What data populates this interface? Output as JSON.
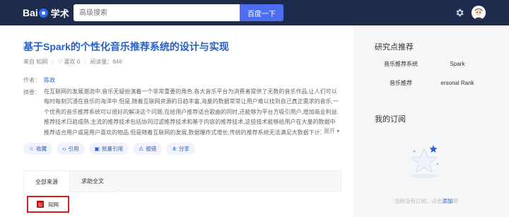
{
  "topbar": {
    "logo_text": "Bai",
    "logo_du": "du",
    "logo_xueshu": "学术",
    "search_placeholder": "高级搜索",
    "search_button": "百度一下"
  },
  "paper": {
    "title": "基于Spark的个性化音乐推荐系统的设计与实现",
    "source": "来自 知网",
    "likes": "喜欢 0",
    "reads": "阅读量：646",
    "author_label": "作者：",
    "author": "陈政",
    "abstract_label": "摘要：",
    "abstract": "在互联网的发展潮流中,音乐无疑扮演着一个非常重要的角色.各大音乐平台为消费者提供了无数的音乐作品,让人们可以每时每刻沉浸在音乐的海洋中.但是,随着互联网资源的日趋丰富,海量的数据常常让用户难以找到自己真正需求的音乐,一个优秀的音乐推荐系统可以很好的解决这个问题,在给用户推荐适合歌曲的同时,还能够为平台方吸引用户,增加商业利益.推荐技术日趋成熟,主流的推荐技术包括协同过滤推荐技术和基于内容的推荐技术,这些技术能够给用户在大量的数据中推荐适合用户或是用户喜欢的物品.但是随着互联网的发展,数据爆炸式增长,传统的推荐系统无法满足大数据下计算的需求,在准确度上也",
    "expand": "展开"
  },
  "actions": [
    {
      "icon": "star-icon",
      "label": "收藏"
    },
    {
      "icon": "quote-icon",
      "label": "引用"
    },
    {
      "icon": "batch-icon",
      "label": "批量引用"
    },
    {
      "icon": "warning-icon",
      "label": "报错"
    },
    {
      "icon": "share-icon",
      "label": "分享"
    }
  ],
  "tabs": {
    "all_sources": "全部来源",
    "request_fulltext": "求助全文"
  },
  "source_item": {
    "logo": "知",
    "label": "知网"
  },
  "sidebar": {
    "research_title": "研究点推荐",
    "keywords": [
      "音乐推荐系统",
      "Spark",
      "音乐推荐",
      "ersonal Rank"
    ],
    "subs_title": "我的订阅",
    "empty_text": "当前没有订阅，点击",
    "empty_link": "添加",
    "empty_suffix": "吧"
  },
  "colors": {
    "topbar": "#1f2b4d",
    "accent": "#2860c6",
    "search_button": "#4e6ef2",
    "highlight_box": "#d81e1e"
  }
}
